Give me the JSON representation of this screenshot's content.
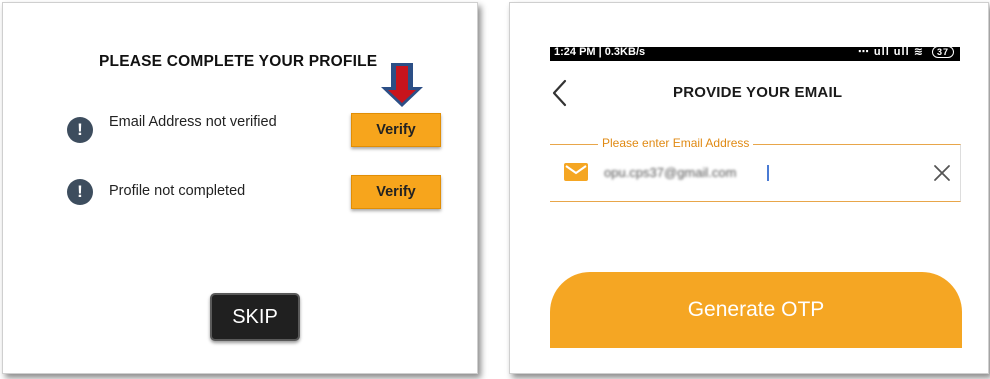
{
  "left_dialog": {
    "title": "PLEASE COMPLETE YOUR PROFILE",
    "items": [
      {
        "label": "Email Address not verified",
        "button": "Verify",
        "icon": "exclamation-icon"
      },
      {
        "label": "Profile not completed",
        "button": "Verify",
        "icon": "exclamation-icon"
      }
    ],
    "skip_label": "SKIP",
    "warn_icon_glyph": "!"
  },
  "right_screen": {
    "status_bar": {
      "time_speed": "1:24 PM | 0.3KB/s",
      "right_text": "⋯ ull ull ≋",
      "battery": "37"
    },
    "title": "PROVIDE YOUR EMAIL",
    "email_field": {
      "legend": "Please enter Email Address",
      "value": "opu.cps37@gmail.com"
    },
    "generate_label": "Generate OTP"
  },
  "colors": {
    "accent_orange": "#f5a623",
    "verify_orange": "#f7a51c",
    "field_outline": "#e8a64a",
    "legend_text": "#e08a14",
    "arrow_red": "#c8141c",
    "arrow_blue": "#2c4f86"
  }
}
